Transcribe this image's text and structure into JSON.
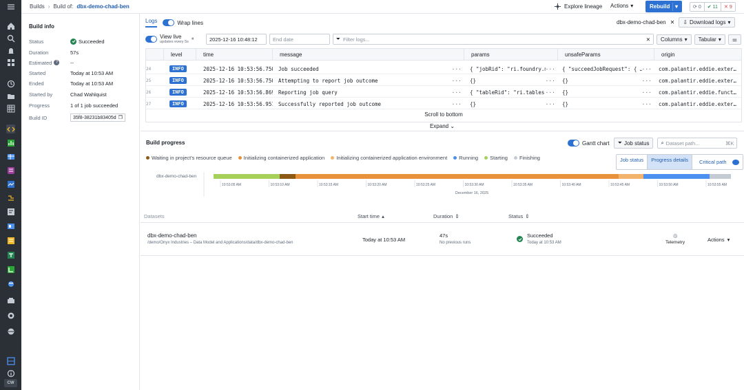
{
  "rail": {
    "icons": [
      "menu-icon",
      "home-icon",
      "search-icon",
      "notifications-icon",
      "apps-icon",
      "history-icon",
      "folder-icon",
      "grid-icon",
      "code-icon",
      "chart-icon",
      "table-icon",
      "ontology-icon",
      "monitor-icon",
      "pipeline-icon",
      "object-icon",
      "dashboard-icon",
      "notebook-icon",
      "transform-icon",
      "workflow-icon",
      "settings-icon",
      "help-icon",
      "layout-icon"
    ],
    "avatar": "CW"
  },
  "topbar": {
    "crumbs": [
      "Builds",
      "Build of:",
      "dbx-demo-chad-ben"
    ],
    "explore_lineage": "Explore lineage",
    "actions": "Actions",
    "rebuild": "Rebuild",
    "counts": {
      "running": "0",
      "succeeded": "11",
      "failed": "9"
    }
  },
  "build_info": {
    "title": "Build info",
    "rows": [
      {
        "key": "Status",
        "value": "Succeeded"
      },
      {
        "key": "Duration",
        "value": "57s"
      },
      {
        "key": "Estimated",
        "value": "--"
      },
      {
        "key": "Started",
        "value": "Today at 10:53 AM"
      },
      {
        "key": "Ended",
        "value": "Today at 10:53 AM"
      },
      {
        "key": "Started by",
        "value": "Chad Wahlquist"
      },
      {
        "key": "Progress",
        "value": "1 of 1 job succeeded"
      },
      {
        "key": "Build ID",
        "value": "35f8-38231b83405d"
      }
    ]
  },
  "logs": {
    "tab_logs": "Logs",
    "wrap_lines": "Wrap lines",
    "dataset_name": "dbx-demo-chad-ben",
    "download_logs": "Download logs",
    "view_live": "View live",
    "view_live_sub": "updates every 5s",
    "start_date": "2025-12-16 10:48:12",
    "end_date_placeholder": "End date",
    "filter_placeholder": "Filter logs...",
    "columns_btn": "Columns",
    "tabular_btn": "Tabular",
    "headers": [
      "level",
      "time",
      "message",
      "params",
      "unsafeParams",
      "origin"
    ],
    "rows": [
      {
        "num": "24",
        "level": "INFO",
        "time": "2025-12-16 10:53:56.750",
        "message": "Job succeeded",
        "params": "{ \"jobRid\": \"ri.foundry.m…",
        "unsafe": "{ \"succeedJobRequest\": { …",
        "origin": "com.palantir.eddie.exter…"
      },
      {
        "num": "25",
        "level": "INFO",
        "time": "2025-12-16 10:53:56.750",
        "message": "Attempting to report job outcome",
        "params": "{}",
        "unsafe": "{}",
        "origin": "com.palantir.eddie.exter…"
      },
      {
        "num": "26",
        "level": "INFO",
        "time": "2025-12-16 10:53:56.869",
        "message": "Reporting job query",
        "params": "{ \"tableRid\": \"ri.tables.…",
        "unsafe": "{}",
        "origin": "com.palantir.eddie.funct…"
      },
      {
        "num": "27",
        "level": "INFO",
        "time": "2025-12-16 10:53:56.951",
        "message": "Successfully reported job outcome",
        "params": "{}",
        "unsafe": "{}",
        "origin": "com.palantir.eddie.exter…"
      }
    ],
    "scroll_to_bottom": "Scroll to bottom",
    "expand": "Expand"
  },
  "build_progress": {
    "title": "Build progress",
    "gantt_chart": "Gantt chart",
    "job_status": "Job status",
    "dataset_path_placeholder": "Dataset path...",
    "legend": [
      {
        "label": "Waiting in project's resource queue",
        "color": "#8c5a14"
      },
      {
        "label": "Initializing containerized application",
        "color": "#e8913a"
      },
      {
        "label": "Initializing containerized application environment",
        "color": "#f2b46b"
      },
      {
        "label": "Running",
        "color": "#4c90f0"
      },
      {
        "label": "Starting",
        "color": "#a6d05a"
      },
      {
        "label": "Finishing",
        "color": "#c5cbd3"
      }
    ],
    "view_tabs": [
      "Job status",
      "Progress details",
      "Critical path"
    ],
    "gantt": {
      "row_label": "dbx-demo-chad-ben",
      "ticks": [
        "10:53:05 AM",
        "10:53:10 AM",
        "10:53:15 AM",
        "10:53:20 AM",
        "10:53:25 AM",
        "10:53:30 AM",
        "10:53:35 AM",
        "10:53:40 AM",
        "10:53:45 AM",
        "10:53:50 AM",
        "10:53:55 AM"
      ],
      "date": "December 16, 2025"
    }
  },
  "datasets": {
    "headers": {
      "datasets": "Datasets",
      "start_time": "Start time",
      "duration": "Duration",
      "status": "Status"
    },
    "row": {
      "name": "dbx-demo-chad-ben",
      "path": "/demo/Onyx Industries – Data Model and Applications/data/dbx-demo-chad-ben",
      "start_time": "Today at 10:53 AM",
      "duration": "47s",
      "duration_sub": "No previous runs",
      "status": "Succeeded",
      "status_sub": "Today at 10:53 AM",
      "telemetry": "Telemetry",
      "actions": "Actions"
    }
  },
  "colors": {
    "accent": "#2d72d2",
    "success": "#238551",
    "rail": "#2b2f36"
  }
}
